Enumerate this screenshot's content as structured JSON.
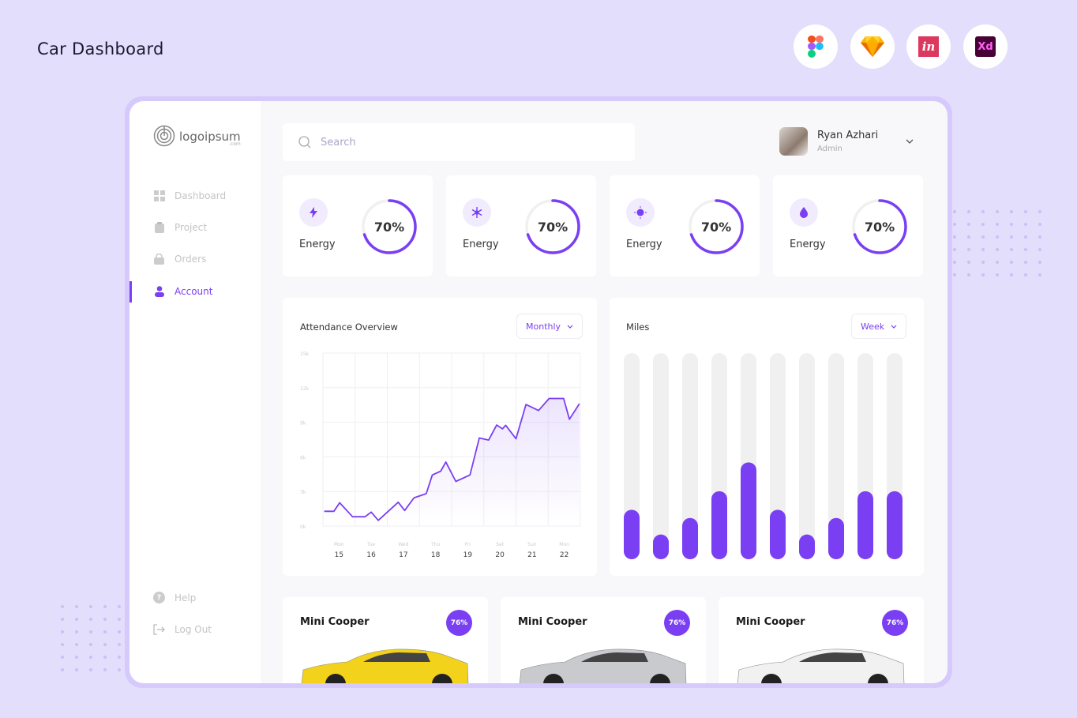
{
  "page_title": "Car Dashboard",
  "tools": [
    {
      "name": "figma-icon"
    },
    {
      "name": "sketch-icon"
    },
    {
      "name": "invision-icon",
      "text": "in"
    },
    {
      "name": "adobe-xd-icon",
      "text": "Xd"
    }
  ],
  "brand": {
    "logo_text": "logoipsum",
    "logo_sub": ".com"
  },
  "sidebar": {
    "items": [
      {
        "label": "Dashboard",
        "icon": "grid-icon",
        "active": false
      },
      {
        "label": "Project",
        "icon": "clipboard-icon",
        "active": false
      },
      {
        "label": "Orders",
        "icon": "bag-icon",
        "active": false
      },
      {
        "label": "Account",
        "icon": "user-icon",
        "active": true
      }
    ],
    "footer": [
      {
        "label": "Help",
        "icon": "help-icon"
      },
      {
        "label": "Log Out",
        "icon": "logout-icon"
      }
    ]
  },
  "search": {
    "placeholder": "Search"
  },
  "user": {
    "name": "Ryan Azhari",
    "role": "Admin"
  },
  "stats": [
    {
      "label": "Energy",
      "value": "70%",
      "percent": 70,
      "icon": "lightning-icon"
    },
    {
      "label": "Energy",
      "value": "70%",
      "percent": 70,
      "icon": "snowflake-icon"
    },
    {
      "label": "Energy",
      "value": "70%",
      "percent": 70,
      "icon": "sun-icon"
    },
    {
      "label": "Energy",
      "value": "70%",
      "percent": 70,
      "icon": "drop-icon"
    }
  ],
  "colors": {
    "accent": "#7a3ff2",
    "track": "#f0f0f0",
    "background": "#e4defd"
  },
  "chart_data": [
    {
      "type": "area",
      "title": "Attendance Overview",
      "filter": "Monthly",
      "y_ticks": [
        "15k",
        "12k",
        "9k",
        "6k",
        "3k",
        "0k"
      ],
      "ylim": [
        0,
        15
      ],
      "x_ticks": [
        {
          "day": "Mon",
          "date": "15"
        },
        {
          "day": "Tue",
          "date": "16"
        },
        {
          "day": "Wed",
          "date": "17"
        },
        {
          "day": "Thu",
          "date": "18"
        },
        {
          "day": "Fri",
          "date": "19"
        },
        {
          "day": "Sat",
          "date": "20"
        },
        {
          "day": "Sun",
          "date": "21"
        },
        {
          "day": "Mon",
          "date": "22"
        }
      ],
      "xlim": [
        14.5,
        22.5
      ],
      "grid": true,
      "x": [
        14.54,
        14.84,
        15.02,
        15.42,
        15.81,
        16.0,
        16.22,
        16.84,
        17.04,
        17.33,
        17.71,
        17.9,
        18.16,
        18.32,
        18.63,
        19.07,
        19.36,
        19.65,
        19.9,
        20.08,
        20.18,
        20.5,
        20.81,
        21.2,
        21.53,
        21.98,
        22.16,
        22.47
      ],
      "y": [
        1.28,
        1.28,
        2.02,
        0.81,
        0.81,
        1.21,
        0.49,
        2.07,
        1.35,
        2.45,
        2.81,
        4.43,
        4.76,
        5.55,
        3.87,
        4.43,
        7.64,
        7.46,
        8.76,
        8.43,
        8.74,
        7.57,
        10.54,
        10.02,
        11.06,
        11.06,
        9.26,
        10.61
      ]
    },
    {
      "type": "bar",
      "title": "Miles",
      "filter": "Week",
      "values": [
        0.24,
        0.12,
        0.2,
        0.33,
        0.47,
        0.24,
        0.12,
        0.2,
        0.33,
        0.33
      ],
      "ylim": [
        0,
        1
      ]
    }
  ],
  "cars": [
    {
      "name": "Mini Cooper",
      "badge": "76%",
      "color": "#f3d21c"
    },
    {
      "name": "Mini Cooper",
      "badge": "76%",
      "color": "#c9cacd"
    },
    {
      "name": "Mini Cooper",
      "badge": "76%",
      "color": "#f1f1f1"
    }
  ]
}
